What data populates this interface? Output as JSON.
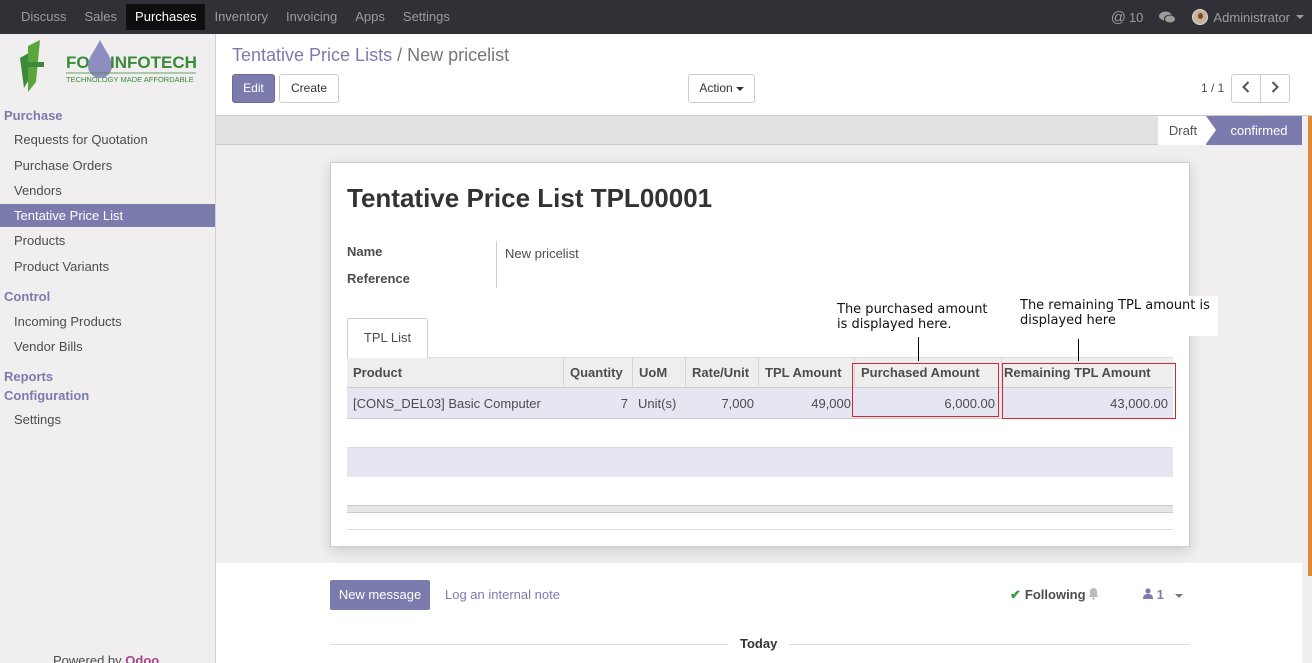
{
  "topbar": {
    "menu": [
      "Discuss",
      "Sales",
      "Purchases",
      "Inventory",
      "Invoicing",
      "Apps",
      "Settings"
    ],
    "active_menu": "Purchases",
    "messages_count": "10",
    "user": "Administrator"
  },
  "sidebar": {
    "logo_text": "FO INFOTECH",
    "logo_tagline": "TECHNOLOGY MADE AFFORDABLE",
    "sections": {
      "purchase": "Purchase",
      "control": "Control",
      "reports": "Reports",
      "configuration": "Configuration"
    },
    "purchase_items": [
      "Requests for Quotation",
      "Purchase Orders",
      "Vendors",
      "Tentative Price List",
      "Products",
      "Product Variants"
    ],
    "control_items": [
      "Incoming Products",
      "Vendor Bills"
    ],
    "configuration_items": [
      "Settings"
    ],
    "powered_by": "Powered by",
    "powered_brand": "Odoo"
  },
  "control_panel": {
    "breadcrumb_parent": "Tentative Price Lists",
    "breadcrumb_separator": "/",
    "breadcrumb_current": "New pricelist",
    "edit_label": "Edit",
    "create_label": "Create",
    "action_label": "Action",
    "pager": "1 / 1"
  },
  "statusbar": {
    "states": [
      "Draft",
      "confirmed"
    ],
    "current": "confirmed"
  },
  "form": {
    "title": "Tentative Price List TPL00001",
    "name_label": "Name",
    "name_value": "New pricelist",
    "reference_label": "Reference",
    "tab_label": "TPL List",
    "columns": [
      "Product",
      "Quantity",
      "UoM",
      "Rate/Unit",
      "TPL Amount",
      "Purchased Amount",
      "Remaining TPL Amount"
    ],
    "rows": [
      [
        "[CONS_DEL03] Basic Computer",
        "7",
        "Unit(s)",
        "7,000",
        "49,000",
        "6,000.00",
        "43,000.00"
      ]
    ]
  },
  "annotations": {
    "purchased_note": "The purchased amount is displayed here.",
    "remaining_note": "The remaining TPL amount is displayed here",
    "highlight_color": "#d9262e"
  },
  "chatter": {
    "new_message": "New message",
    "log_note": "Log an internal note",
    "following": "Following",
    "followers_count": "1",
    "today": "Today"
  },
  "colors": {
    "accent": "#7c7bad",
    "topbar": "#2f3136"
  }
}
